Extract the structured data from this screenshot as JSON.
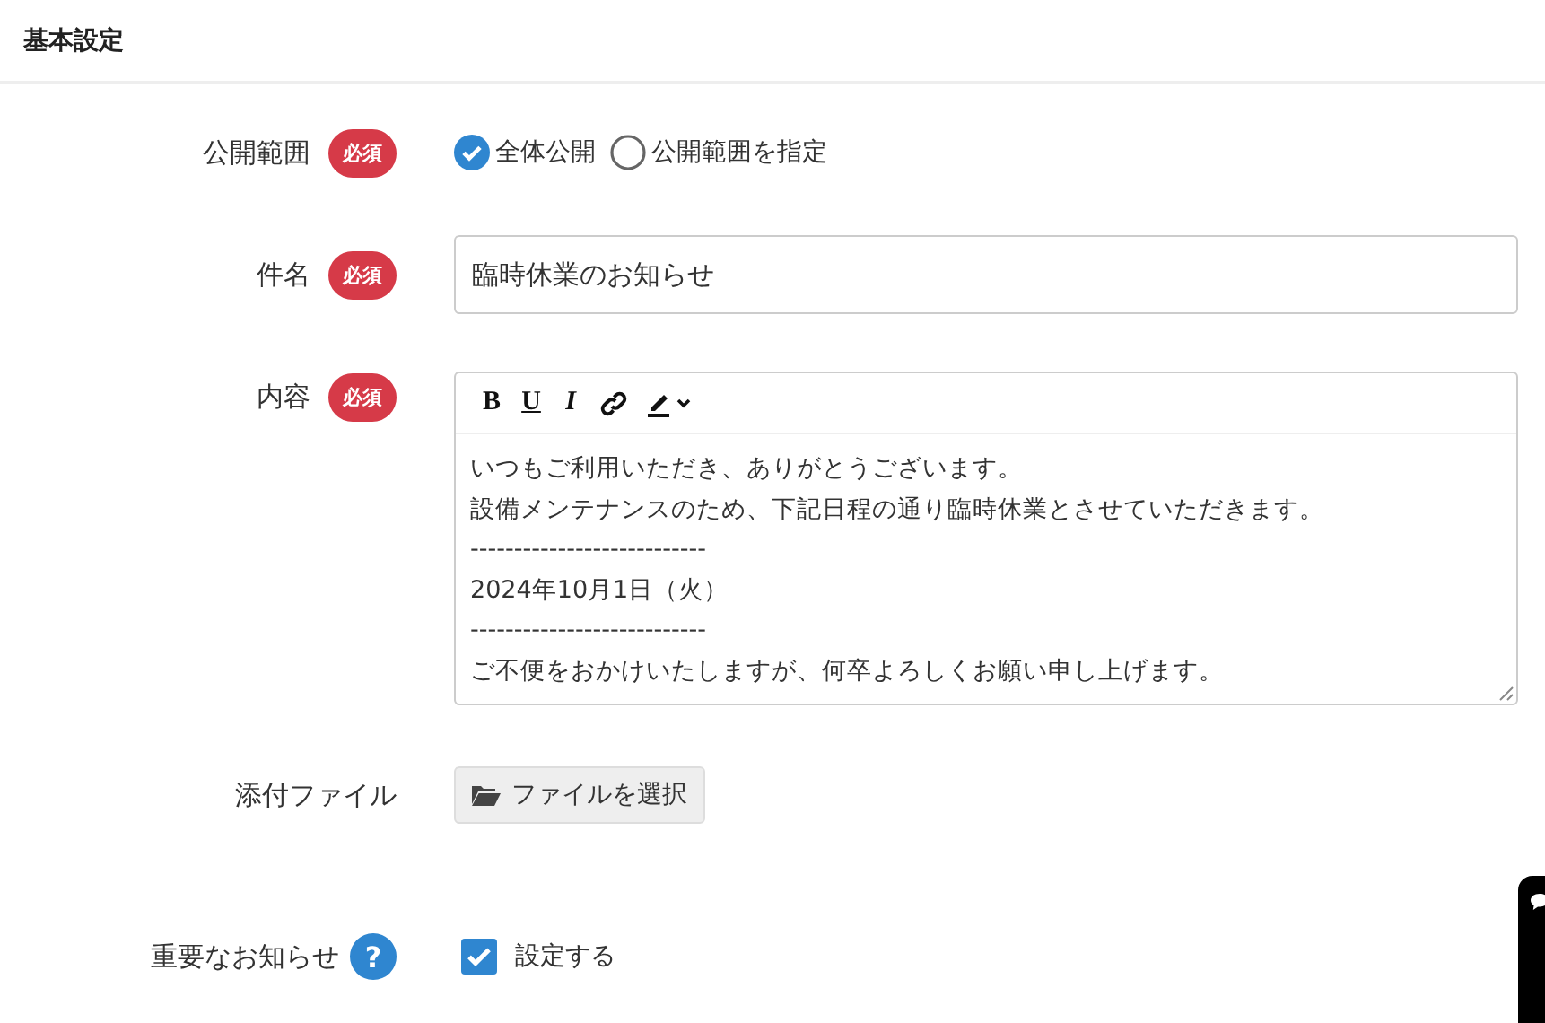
{
  "section_title": "基本設定",
  "fields": [
    {
      "kind": "radio",
      "label": "公開範囲",
      "badge": "必須",
      "options": [
        {
          "label": "全体公開",
          "selected": true
        },
        {
          "label": "公開範囲を指定",
          "selected": false
        }
      ]
    },
    {
      "kind": "text",
      "label": "件名",
      "badge": "必須",
      "value": "臨時休業のお知らせ"
    },
    {
      "kind": "editor",
      "label": "内容",
      "badge": "必須",
      "toolbar": [
        "B",
        "U",
        "I"
      ],
      "lines": [
        "いつもご利用いただき、ありがとうございます。",
        "設備メンテナンスのため、下記日程の通り臨時休業とさせていただきます。",
        "---------------------------",
        "2024年10月1日（火）",
        "---------------------------",
        "ご不便をおかけいたしますが、何卒よろしくお願い申し上げます。"
      ]
    },
    {
      "kind": "file",
      "label": "添付ファイル",
      "button": "ファイルを選択"
    },
    {
      "kind": "checkbox",
      "label": "重要なお知らせ",
      "help": "?",
      "option": {
        "label": "設定する",
        "checked": true
      }
    }
  ]
}
